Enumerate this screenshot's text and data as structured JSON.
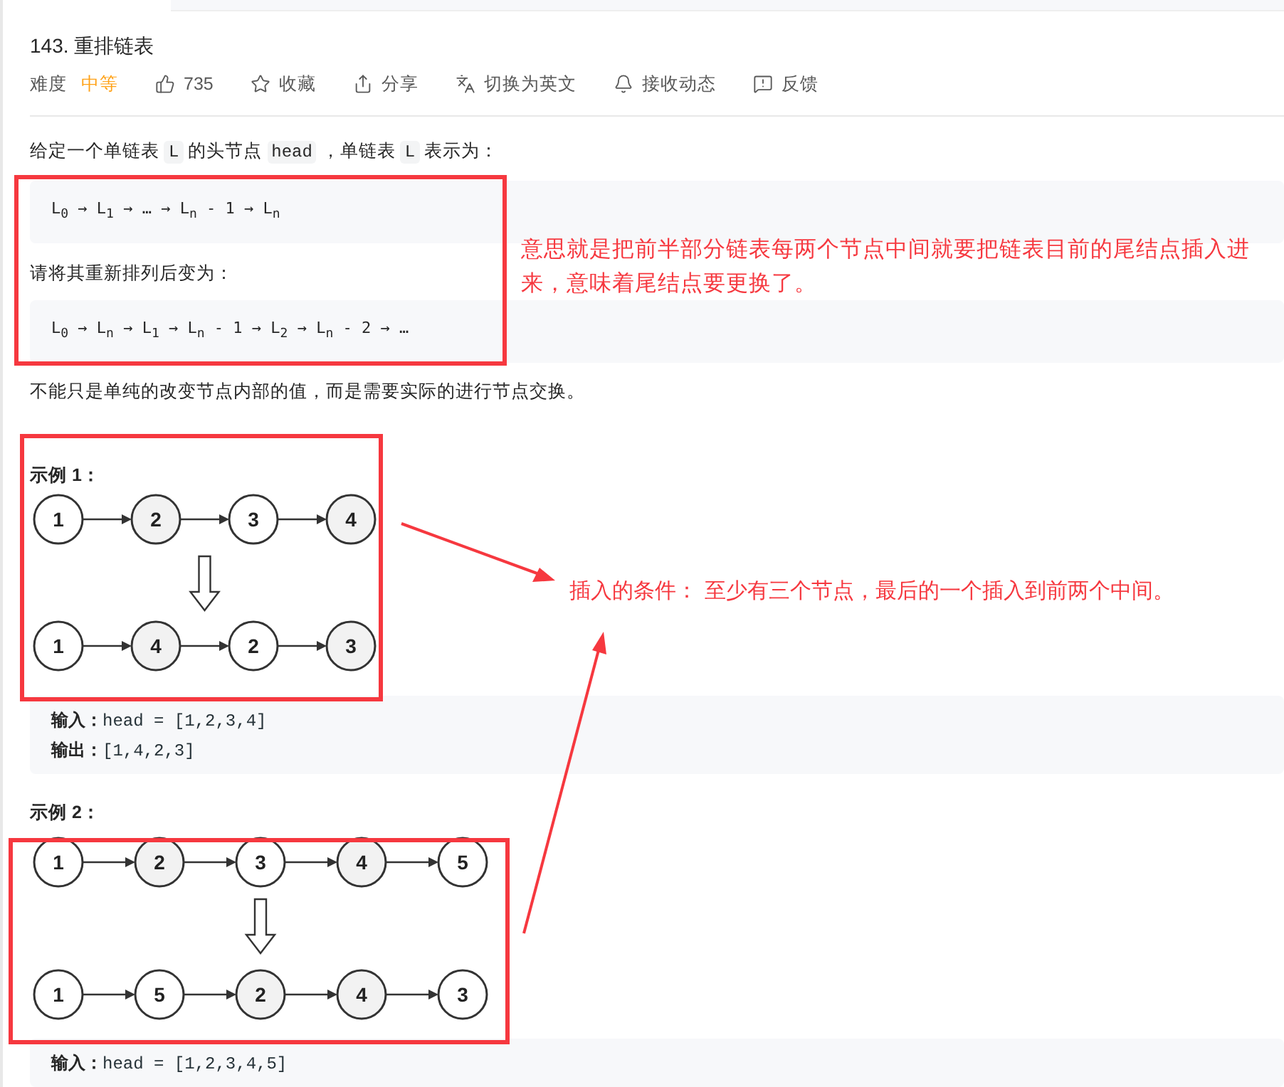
{
  "header": {
    "title": "143. 重排链表",
    "difficulty_label": "难度",
    "difficulty": {
      "label": "中等",
      "kind": "medium"
    },
    "actions": [
      {
        "kind": "like",
        "label": "735"
      },
      {
        "kind": "star",
        "label": "收藏"
      },
      {
        "kind": "share",
        "label": "分享"
      },
      {
        "kind": "translate",
        "label": "切换为英文"
      },
      {
        "kind": "bell",
        "label": "接收动态"
      },
      {
        "kind": "feedback",
        "label": "反馈"
      }
    ]
  },
  "intro": [
    {
      "kind": "text",
      "text": "给定一个单链表 "
    },
    {
      "kind": "code",
      "text": "L"
    },
    {
      "kind": "text",
      "text": " 的头节点 "
    },
    {
      "kind": "code",
      "text": "head"
    },
    {
      "kind": "text",
      "text": " ，单链表 "
    },
    {
      "kind": "code",
      "text": "L"
    },
    {
      "kind": "text",
      "text": " 表示为："
    }
  ],
  "original_list": "L$_{0}$ → L$_{1}$ → … → L$_{n}$ - 1 → L$_{n}$",
  "reorder_prompt": "请将其重新排列后变为：",
  "reordered_list": "L$_{0}$ → L$_{n}$ → L$_{1}$ → L$_{n}$ - 1 → L$_{2}$ → L$_{n}$ - 2 → …",
  "note": "不能只是单纯的改变节点内部的值，而是需要实际的进行节点交换。",
  "examples": [
    {
      "title": "示例 1：",
      "before": [
        {
          "value": "1",
          "shaded": false
        },
        {
          "value": "2",
          "shaded": true
        },
        {
          "value": "3",
          "shaded": false
        },
        {
          "value": "4",
          "shaded": true
        }
      ],
      "after": [
        {
          "value": "1",
          "shaded": false
        },
        {
          "value": "4",
          "shaded": true
        },
        {
          "value": "2",
          "shaded": false
        },
        {
          "value": "3",
          "shaded": true
        }
      ],
      "io": [
        {
          "label": "输入：",
          "value": "head = [1,2,3,4]"
        },
        {
          "label": "输出：",
          "value": "[1,4,2,3]"
        }
      ]
    },
    {
      "title": "示例 2：",
      "before": [
        {
          "value": "1",
          "shaded": false
        },
        {
          "value": "2",
          "shaded": true
        },
        {
          "value": "3",
          "shaded": false
        },
        {
          "value": "4",
          "shaded": true
        },
        {
          "value": "5",
          "shaded": false
        }
      ],
      "after": [
        {
          "value": "1",
          "shaded": false
        },
        {
          "value": "5",
          "shaded": false
        },
        {
          "value": "2",
          "shaded": true
        },
        {
          "value": "4",
          "shaded": true
        },
        {
          "value": "3",
          "shaded": false
        }
      ],
      "io": [
        {
          "label": "输入：",
          "value": "head = [1,2,3,4,5]"
        }
      ]
    }
  ],
  "annotations": [
    "意思就是把前半部分链表每两个节点中间就要把链表目前的尾结点插入进来，意味着尾结点要更换了。",
    "插入的条件：  至少有三个节点，最后的一个插入到前两个中间。"
  ]
}
